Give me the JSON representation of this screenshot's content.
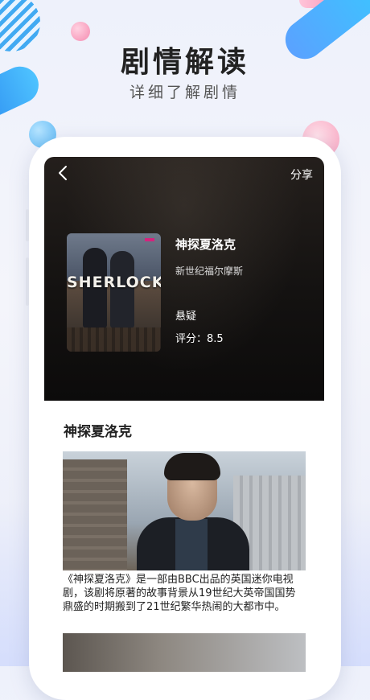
{
  "promo": {
    "headline": "剧情解读",
    "subheadline": "详细了解剧情"
  },
  "header": {
    "back_icon": "chevron-left-icon",
    "share_label": "分享"
  },
  "show": {
    "poster_title": "SHERLOCK",
    "title": "神探夏洛克",
    "subtitle": "新世纪福尔摩斯",
    "genre": "悬疑",
    "rating_label": "评分：",
    "rating_value": "8.5"
  },
  "article": {
    "section_title": "神探夏洛克",
    "description": "《神探夏洛克》是一部由BBC出品的英国迷你电视剧，该剧将原著的故事背景从19世纪大英帝国国势鼎盛的时期搬到了21世纪繁华热闹的大都市中。"
  },
  "colors": {
    "accent_blue": "#39a6f2",
    "accent_pink": "#f58bb0",
    "hero_dark": "#141211",
    "text_dark": "#222222"
  }
}
